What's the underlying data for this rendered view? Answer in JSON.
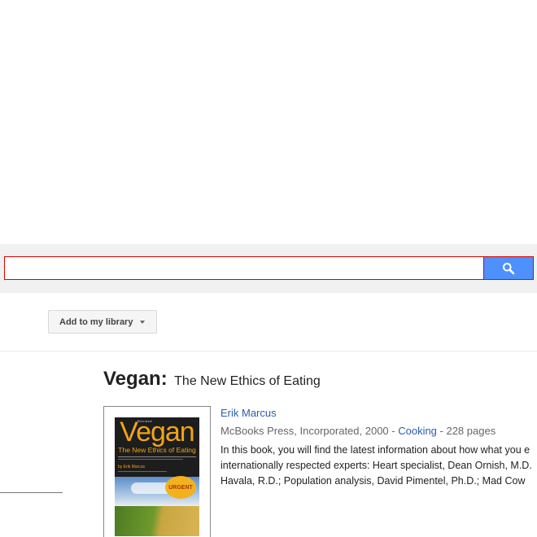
{
  "search": {
    "value": "",
    "icon": "search-icon",
    "accent": "#4d90fe",
    "border_color": "#dd0000"
  },
  "toolbar": {
    "add_library_label": "Add to my library",
    "dropdown_icon": "caret-down-icon"
  },
  "book": {
    "title": "Vegan:",
    "subtitle": "The New Ethics of Eating",
    "author": "Erik Marcus",
    "publisher": "McBooks Press, Incorporated, 2000 - ",
    "category": "Cooking",
    "pages": " - 228 pages",
    "description_lines": [
      "In this book, you will find the latest information about how what you e",
      "internationally respected experts: Heart specialist, Dean Ornish, M.D.",
      "Havala, R.D.; Population analysis, David Pimentel, Ph.D.; Mad Cow"
    ],
    "cover": {
      "small_text": "Revised",
      "title": "Vegan",
      "subtitle": "The New Ethics of Eating",
      "author": "by Erik Marcus",
      "badge": "URGENT"
    }
  }
}
